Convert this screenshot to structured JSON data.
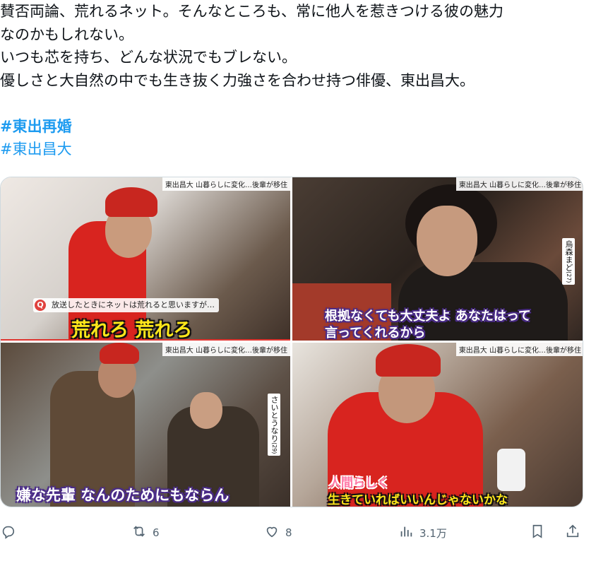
{
  "tweet": {
    "lines": [
      "賛否両論、荒れるネット。そんなところも、常に他人を惹きつける彼の魅力",
      "なのかもしれない。",
      "いつも芯を持ち、どんな状況でもブレない。",
      "優しさと大自然の中でも生き抜く力強さを合わせ持つ俳優、東出昌大。"
    ],
    "hashtags": [
      "#東出再婚",
      "#東出昌大"
    ]
  },
  "media": {
    "panels": [
      {
        "news_label": "東出昌大 山暮らしに変化…後輩が移住",
        "question_badge": "Q",
        "question": "放送したときにネットは荒れると思いますが…",
        "caption": "荒れろ 荒れろ"
      },
      {
        "news_label": "東出昌大 山暮らしに変化…後輩が移住",
        "name_tag": "烏森まど",
        "age": "(27)",
        "caption_line1": "根拠なくても大丈夫よ あなたはって",
        "caption_line2": "言ってくれるから"
      },
      {
        "news_label": "東出昌大 山暮らしに変化…後輩が移住",
        "name_tag": "さいとうなり",
        "age": "(29)",
        "caption": "嫌な先輩 なんのためにもならん"
      },
      {
        "news_label": "東出昌大 山暮らしに変化…後輩が移住",
        "caption_line1": "人間らしく",
        "caption_line2": "生きていればいいんじゃないかな"
      }
    ]
  },
  "actions": {
    "retweets": "6",
    "likes": "8",
    "views": "3.1万"
  },
  "icons": {
    "reply": "reply-icon",
    "retweet": "retweet-icon",
    "like": "heart-icon",
    "views": "views-icon",
    "bookmark": "bookmark-icon",
    "share": "share-icon"
  }
}
